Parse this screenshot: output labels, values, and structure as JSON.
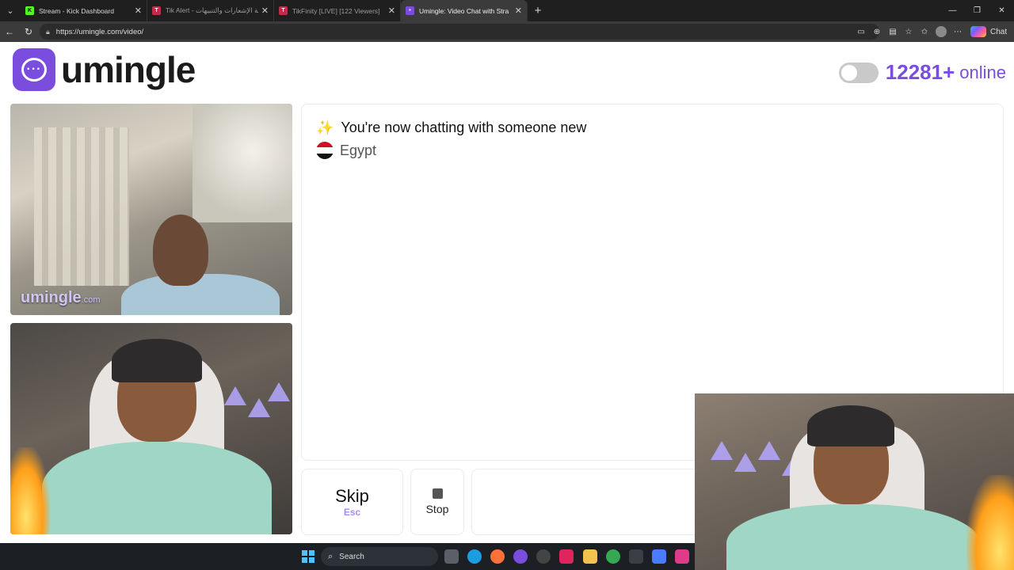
{
  "browser": {
    "tabs": [
      {
        "title": "Stream - Kick Dashboard",
        "favicon": "kick-icon",
        "color": "#53fc18",
        "active": false
      },
      {
        "title": "Tik Alert - خدمة الإشعارات والتنبيهات",
        "favicon": "tikalert-icon",
        "color": "#c22b4b",
        "active": false
      },
      {
        "title": "TikFinity [LIVE] [122 Viewers]",
        "favicon": "tikfinity-icon",
        "color": "#c22b4b",
        "active": false
      },
      {
        "title": "Umingle: Video Chat with Stra",
        "favicon": "umingle-icon",
        "color": "#7b4dde",
        "active": true
      }
    ],
    "url": "https://umingle.com/video/",
    "chat_label": "Chat"
  },
  "site": {
    "brand": "umingle",
    "brand_color": "#7b4dde",
    "online_count": "12281+",
    "online_label": "online"
  },
  "stranger_video": {
    "watermark": "umingle",
    "watermark_suffix": ".com"
  },
  "chat": {
    "system_message": "You're now chatting with someone new",
    "country": "Egypt"
  },
  "controls": {
    "skip_label": "Skip",
    "skip_key": "Esc",
    "stop_label": "Stop"
  },
  "taskbar": {
    "search_placeholder": "Search"
  }
}
